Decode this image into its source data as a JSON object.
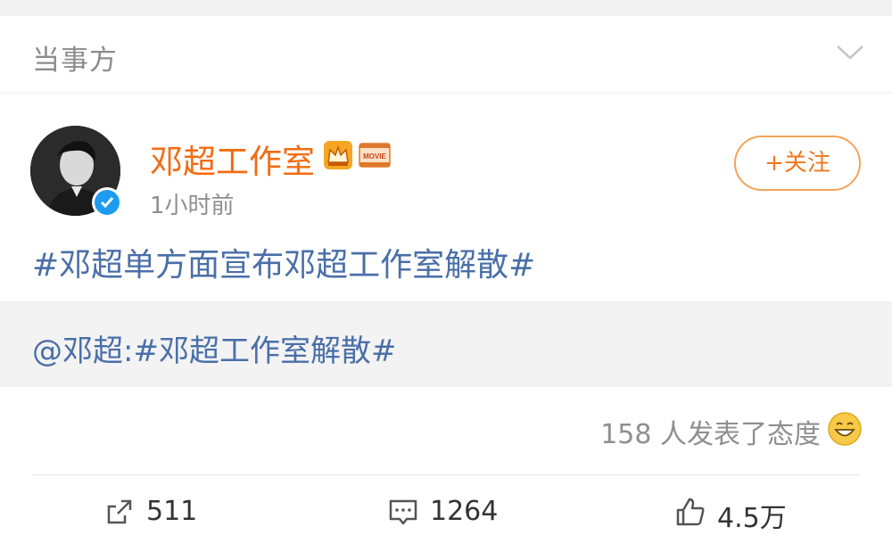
{
  "section": {
    "title": "当事方"
  },
  "post": {
    "author": "邓超工作室",
    "badges": [
      "crown-icon",
      "movie-badge-icon"
    ],
    "movie_badge_text": "MOVIE",
    "time": "1小时前",
    "follow_label": "+关注",
    "text": "#邓超单方面宣布邓超工作室解散#",
    "repost": {
      "text": "@邓超:#邓超工作室解散#"
    },
    "reactions": {
      "summary": "158 人发表了态度"
    },
    "actions": {
      "repost_count": "511",
      "comment_count": "1264",
      "like_count": "4.5万"
    }
  },
  "colors": {
    "author": "#f26c12",
    "link": "#4a6fa8",
    "follow_border": "#f3a35a",
    "verified": "#1d9bf0"
  }
}
